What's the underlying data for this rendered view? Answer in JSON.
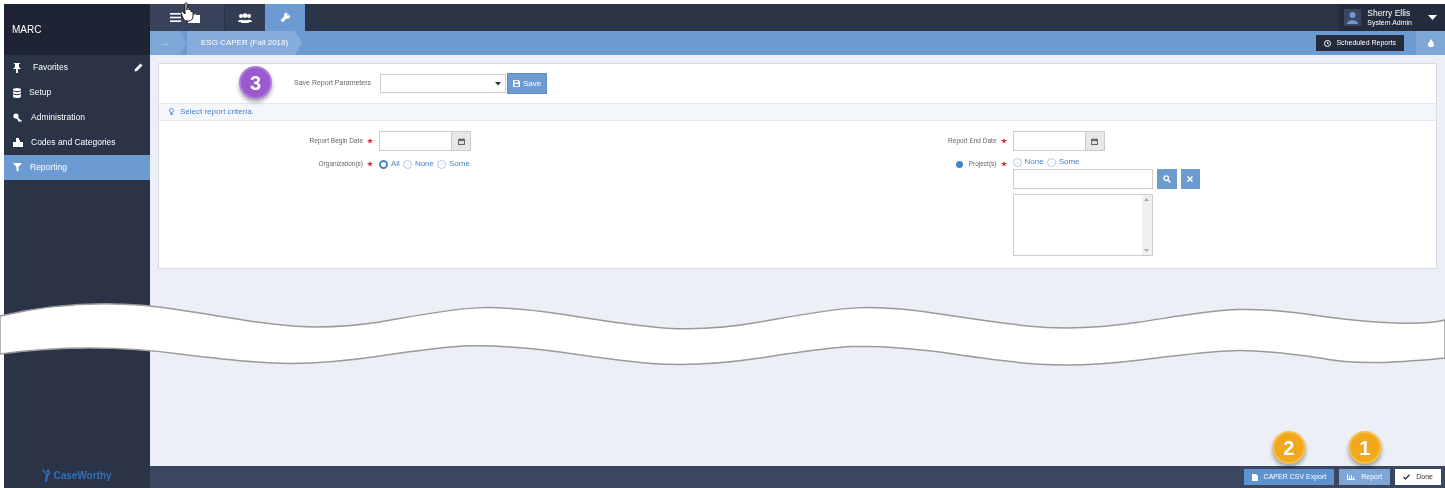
{
  "app": {
    "title": "MARC",
    "brand": "CaseWorthy"
  },
  "toolbar_tabs": [
    {
      "kind": "menu",
      "selected": false
    },
    {
      "kind": "briefcase",
      "selected": false
    },
    {
      "kind": "users",
      "selected": false
    },
    {
      "kind": "wrench",
      "selected": true
    }
  ],
  "user": {
    "name": "Sherry Ellis",
    "role": "System Admin"
  },
  "breadcrumb": [
    "...",
    "ESG CAPER (Fall 2018)"
  ],
  "scheduled_reports": "Scheduled Reports",
  "sidebar": {
    "items": [
      {
        "kind": "pin",
        "label": "Favorites",
        "selected": false,
        "editable": true
      },
      {
        "kind": "database",
        "label": "Setup",
        "selected": false,
        "editable": false
      },
      {
        "kind": "key",
        "label": "Administration",
        "selected": false,
        "editable": false
      },
      {
        "kind": "sitemap",
        "label": "Codes and Categories",
        "selected": false,
        "editable": false
      },
      {
        "kind": "filter",
        "label": "Reporting",
        "selected": true,
        "editable": false
      }
    ]
  },
  "save_parameters": {
    "callout": "3",
    "label": "Save Report Parameters",
    "button": "Save"
  },
  "hint": "Select report criteria.",
  "columns": [
    [
      {
        "kind": "date",
        "label": "Report Begin Date",
        "required": true,
        "help": false
      },
      {
        "kind": "radios",
        "label": "Organization(s)",
        "required": true,
        "help": false,
        "options": [
          {
            "label": "All",
            "selected": true
          },
          {
            "label": "None",
            "selected": false
          },
          {
            "label": "Some",
            "selected": false
          }
        ]
      }
    ],
    [
      {
        "kind": "date",
        "label": "Report End Date",
        "required": true,
        "help": false
      },
      {
        "kind": "picker",
        "label": "Project(s)",
        "required": true,
        "help": true,
        "options": [
          {
            "label": "None",
            "selected": false
          },
          {
            "label": "Some",
            "selected": false
          }
        ]
      }
    ]
  ],
  "footer": {
    "buttons": [
      {
        "kind": "export",
        "label": "CAPER CSV Export",
        "callout": "2"
      },
      {
        "kind": "report",
        "label": "Report",
        "callout": "1"
      },
      {
        "kind": "done",
        "label": "Done"
      }
    ]
  }
}
